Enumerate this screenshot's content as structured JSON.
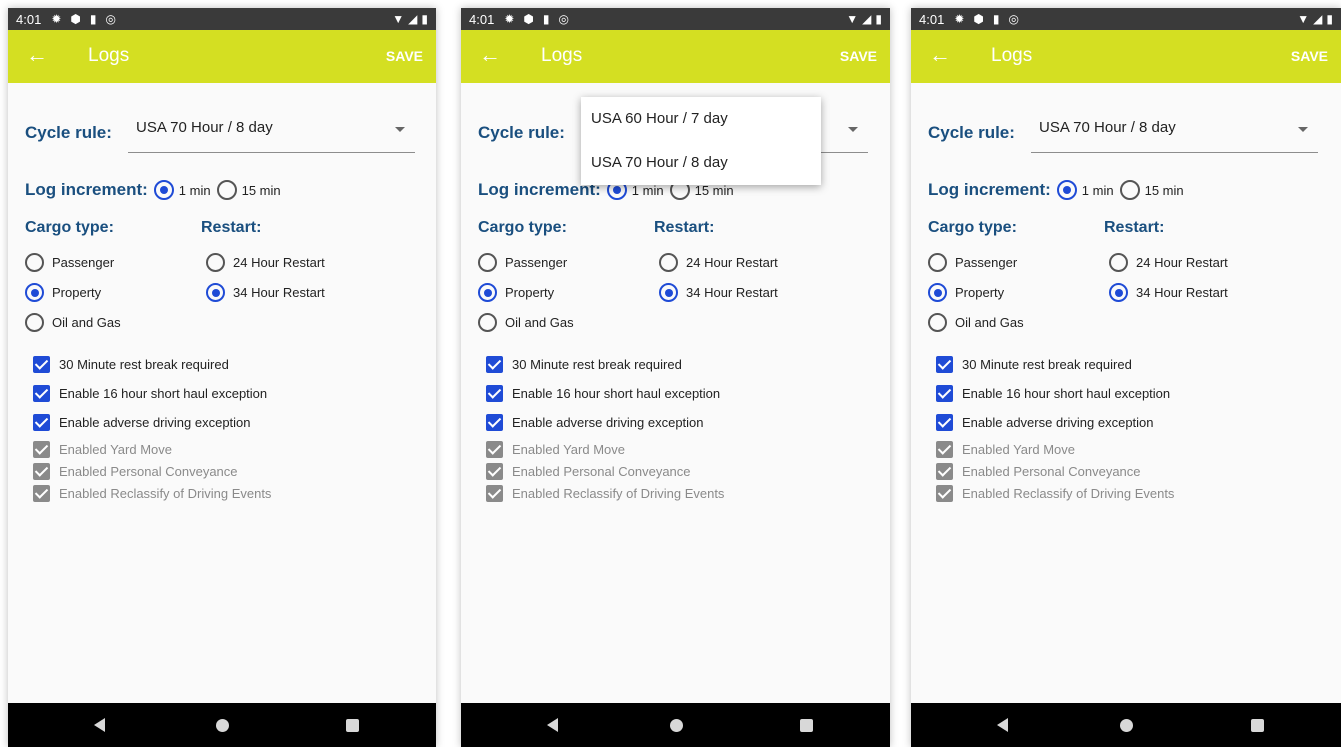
{
  "status": {
    "time": "4:01"
  },
  "appbar": {
    "title": "Logs",
    "save_label": "SAVE",
    "back_glyph": "←"
  },
  "cycle": {
    "label": "Cycle rule:",
    "value": "USA 70 Hour / 8 day",
    "options": [
      "USA 60 Hour / 7 day",
      "USA 70 Hour / 8 day"
    ]
  },
  "increment": {
    "label": "Log increment:",
    "options": [
      "1 min",
      "15 min"
    ],
    "selected": "1 min"
  },
  "cargo": {
    "label": "Cargo type:",
    "options": [
      "Passenger",
      "Property",
      "Oil and Gas"
    ],
    "selected": "Property"
  },
  "restart": {
    "label": "Restart:",
    "options": [
      "24 Hour Restart",
      "34 Hour Restart"
    ],
    "selected": "34 Hour Restart"
  },
  "checks": [
    {
      "label": "30 Minute rest break required",
      "checked": true,
      "enabled": true
    },
    {
      "label": "Enable 16 hour short haul exception",
      "checked": true,
      "enabled": true
    },
    {
      "label": "Enable adverse driving exception",
      "checked": true,
      "enabled": true
    },
    {
      "label": "Enabled Yard Move",
      "checked": true,
      "enabled": false
    },
    {
      "label": "Enabled Personal Conveyance",
      "checked": true,
      "enabled": false
    },
    {
      "label": "Enabled Reclassify of Driving Events",
      "checked": true,
      "enabled": false
    }
  ],
  "colors": {
    "appbar": "#d4df22",
    "heading": "#1a4f7f",
    "accent": "#1f4bd6",
    "disabled": "#8a8a8a"
  },
  "icons": {
    "status": [
      "gear-icon",
      "shield-icon",
      "sd-card-icon",
      "at-icon"
    ],
    "status_right": [
      "wifi-icon",
      "signal-icon",
      "battery-icon"
    ]
  },
  "screens": [
    {
      "id": "screen-1",
      "dropdown_open": false
    },
    {
      "id": "screen-2",
      "dropdown_open": true
    },
    {
      "id": "screen-3",
      "dropdown_open": false
    }
  ]
}
